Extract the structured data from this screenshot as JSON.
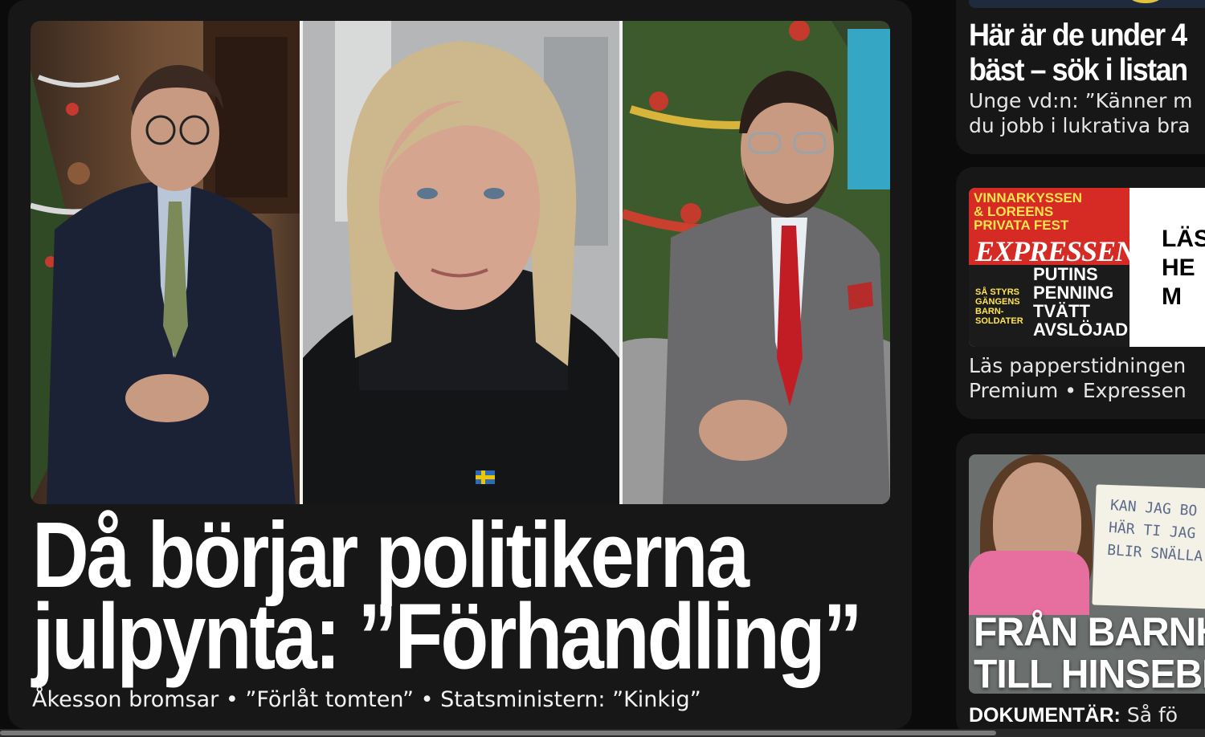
{
  "main_teaser": {
    "headline_line1": "Då börjar politikerna",
    "headline_line2": "julpynta: ”Förhandling”",
    "subline": "Åkesson bromsar • ”Förlåt tomten” • Statsministern: ”Kinkig”",
    "image_panels": [
      "christmas-tree-portrait-left",
      "blonde-woman-portrait",
      "christmas-tree-portrait-right"
    ]
  },
  "side_teasers": [
    {
      "title_line1": "Här är de under 4",
      "title_line2": "bäst – sök i listan",
      "desc_line1": "Unge vd:n: ”Känner m",
      "desc_line2": "du jobb i lukrativa bra"
    },
    {
      "cover": {
        "top_text": "VINNARKYSSEN & LOREENS PRIVATA FEST",
        "logo": "EXPRESSEN",
        "story": "PUTINS PENNING TVÄTT AVSLÖJAD",
        "small": "SÅ STYRS GÄNGENS BARN-SOLDATER"
      },
      "read_label": "LÄS HE M",
      "desc_line1": "Läs papperstidningen",
      "desc_line2": "Premium • Expressen"
    },
    {
      "sign_text": "KAN JAG BO HÄR TI JAG BLIR SNÄLLA",
      "overlay_line1": "FRÅN BARNH",
      "overlay_line2": "TILL HINSEBI",
      "label_bold": "DOKUMENTÄR:",
      "label_rest": " Så fö"
    }
  ],
  "colors": {
    "background": "#0b0b0b",
    "card": "#171717",
    "text": "#ffffff",
    "cover_red": "#d62a24"
  }
}
